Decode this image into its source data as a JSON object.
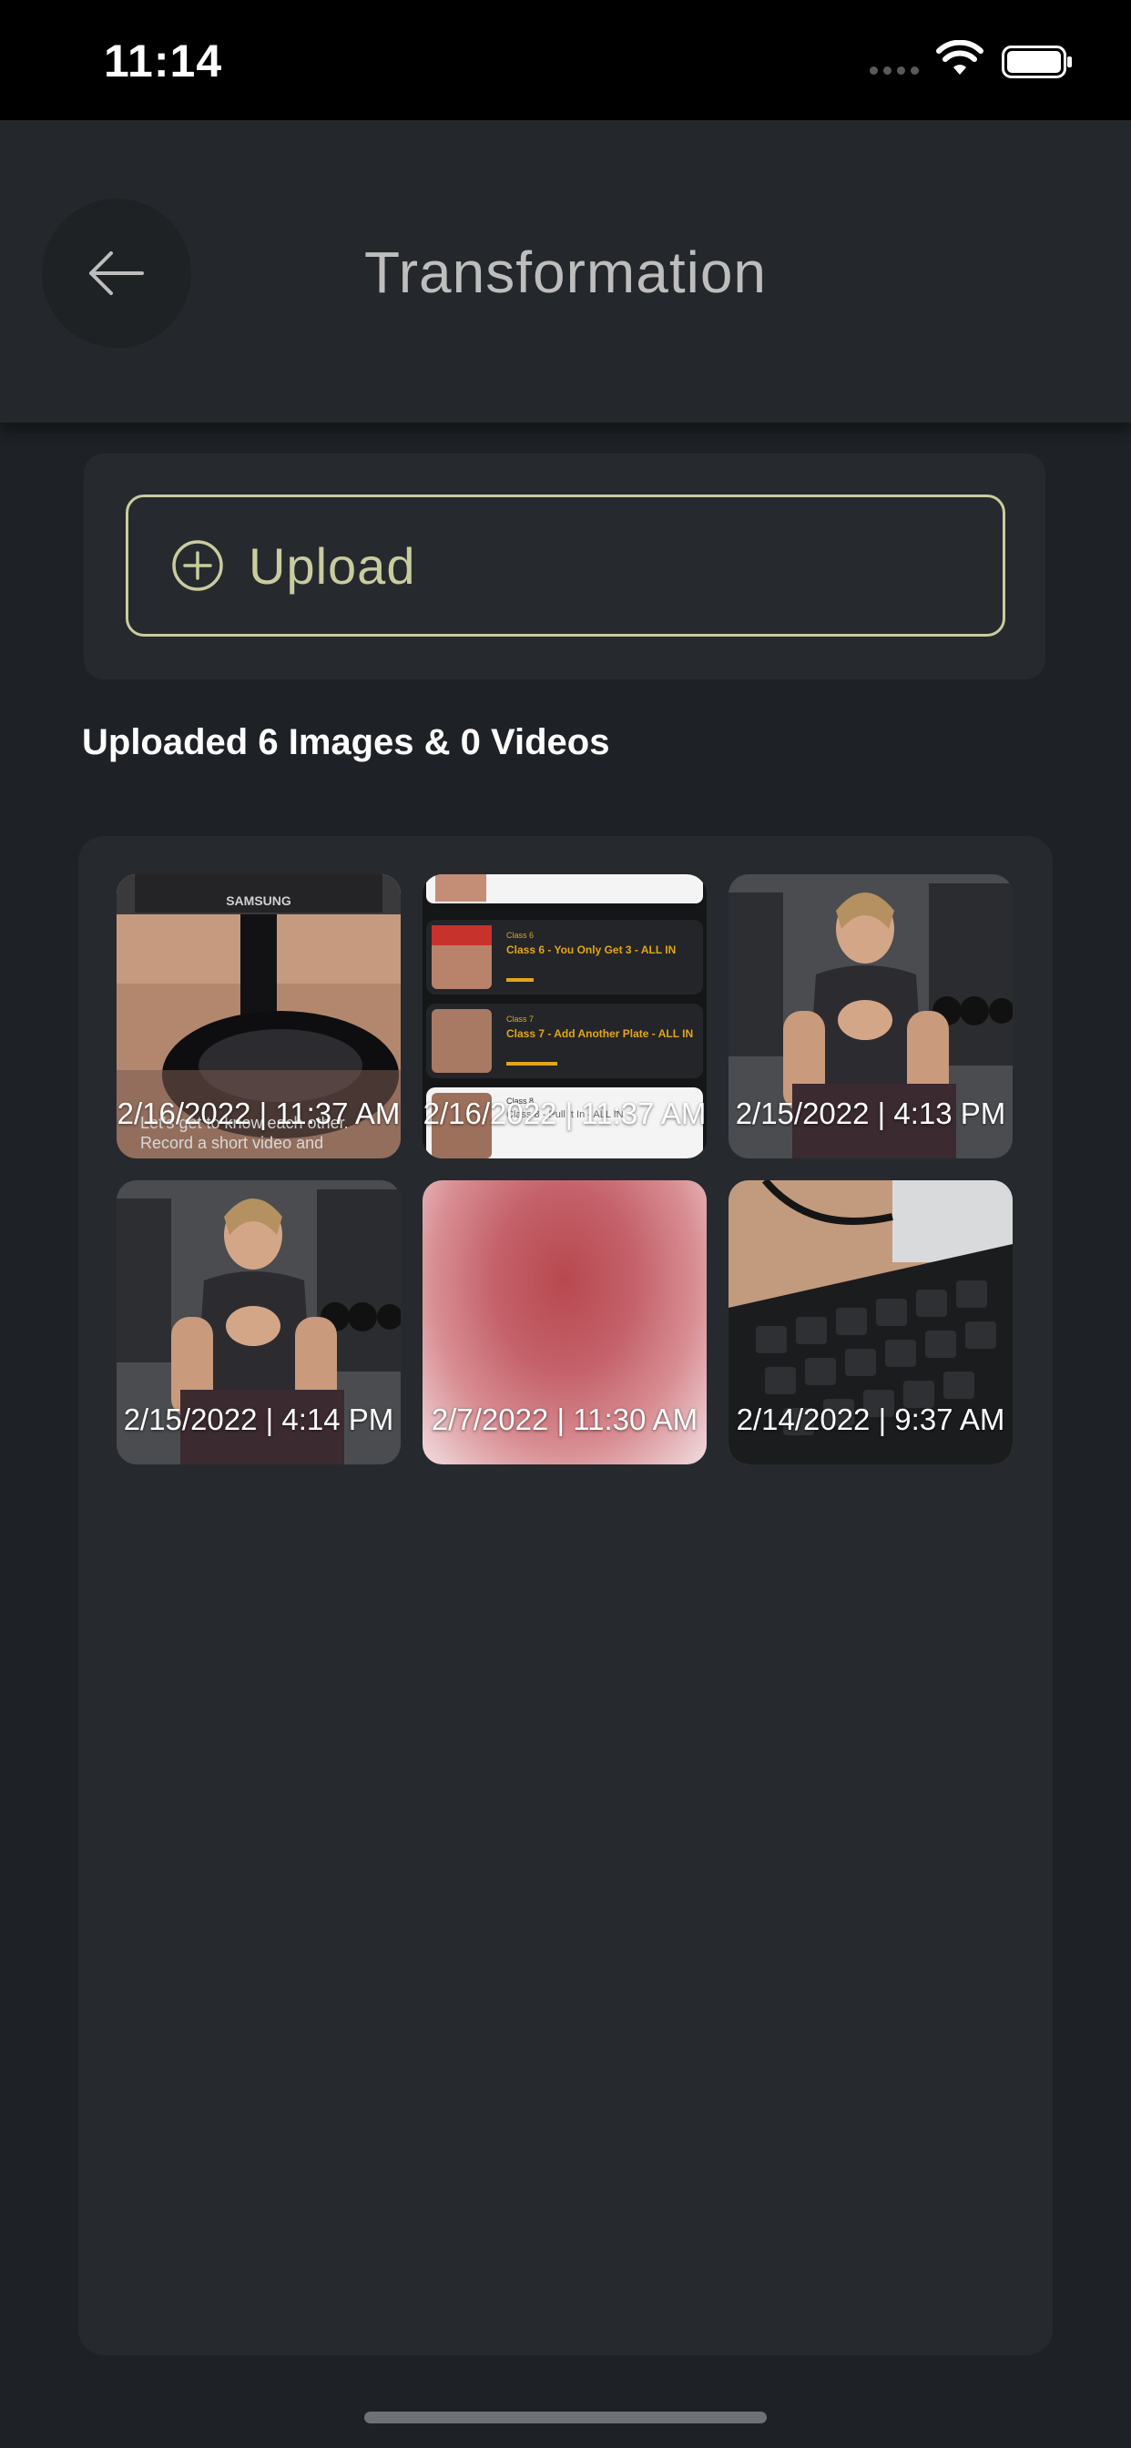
{
  "status_bar": {
    "time": "11:14"
  },
  "header": {
    "title": "Transformation",
    "back_icon": "arrow-left-icon"
  },
  "upload": {
    "label": "Upload",
    "icon": "plus-circle-icon",
    "accent_color": "#c9cc9e"
  },
  "gallery": {
    "summary": "Uploaded 6 Images & 0 Videos",
    "items": [
      {
        "caption": "2/16/2022 | 11:37 AM",
        "overlay_line1": "Let's get to know each other.",
        "overlay_line2": "Record a short video and"
      },
      {
        "caption": "2/16/2022 | 11:37 AM",
        "rows": [
          {
            "label": "Class 6",
            "title": "Class 6 - You Only Get 3 - ALL IN"
          },
          {
            "label": "Class 7",
            "title": "Class 7 - Add Another Plate - ALL IN"
          },
          {
            "label": "Class 8",
            "title": "Class 8 - Pull It In - ALL IN"
          }
        ]
      },
      {
        "caption": "2/15/2022 | 4:13 PM"
      },
      {
        "caption": "2/15/2022 | 4:14 PM"
      },
      {
        "caption": "2/7/2022 | 11:30 AM"
      },
      {
        "caption": "2/14/2022 | 9:37 AM"
      }
    ]
  }
}
